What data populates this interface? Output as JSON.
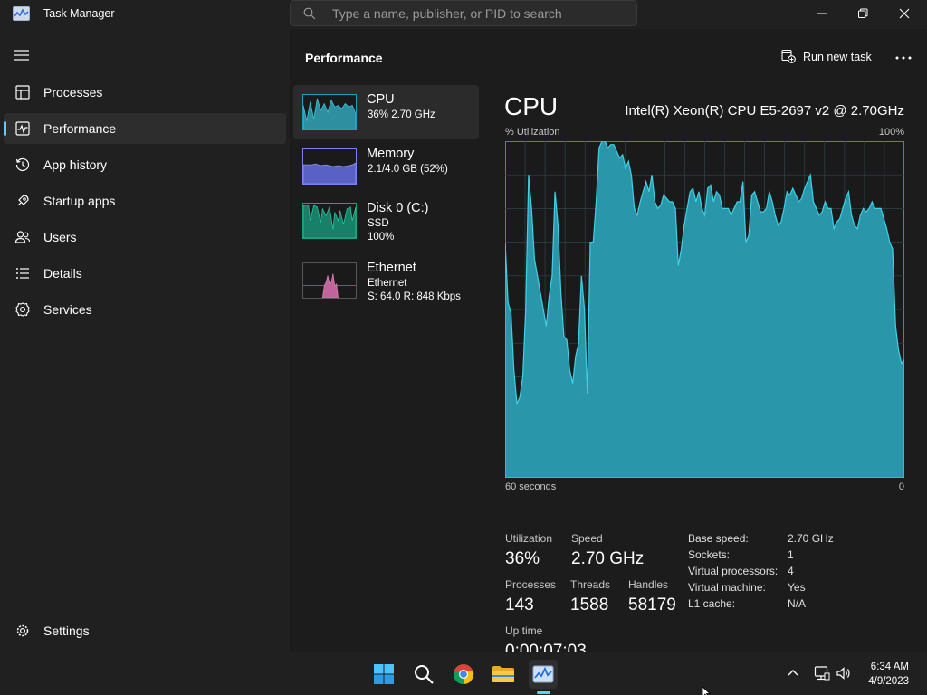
{
  "window": {
    "title": "Task Manager",
    "search_placeholder": "Type a name, publisher, or PID to search"
  },
  "sidebar": {
    "items": [
      {
        "label": "Processes",
        "icon": "processes-icon"
      },
      {
        "label": "Performance",
        "icon": "performance-icon",
        "active": true
      },
      {
        "label": "App history",
        "icon": "app-history-icon"
      },
      {
        "label": "Startup apps",
        "icon": "startup-apps-icon"
      },
      {
        "label": "Users",
        "icon": "users-icon"
      },
      {
        "label": "Details",
        "icon": "details-icon"
      },
      {
        "label": "Services",
        "icon": "services-icon"
      }
    ],
    "settings_label": "Settings"
  },
  "header": {
    "title": "Performance",
    "run_new_task": "Run new task"
  },
  "resources": [
    {
      "name": "CPU",
      "line1": "36%  2.70 GHz",
      "line2": "",
      "color": "#17a2b8",
      "active": true
    },
    {
      "name": "Memory",
      "line1": "2.1/4.0 GB (52%)",
      "line2": "",
      "color": "#7a84e8"
    },
    {
      "name": "Disk 0 (C:)",
      "line1": "SSD",
      "line2": "100%",
      "color": "#1aa380"
    },
    {
      "name": "Ethernet",
      "line1": "Ethernet",
      "line2": "S: 64.0  R: 848 Kbps",
      "color": "#d46aa8"
    }
  ],
  "cpu": {
    "title": "CPU",
    "model": "Intel(R) Xeon(R) CPU E5-2697 v2 @ 2.70GHz",
    "graph_label": "% Utilization",
    "graph_max": "100%",
    "graph_time": "60 seconds",
    "graph_min": "0",
    "stats": {
      "utilization_label": "Utilization",
      "utilization": "36%",
      "speed_label": "Speed",
      "speed": "2.70 GHz",
      "processes_label": "Processes",
      "processes": "143",
      "threads_label": "Threads",
      "threads": "1588",
      "handles_label": "Handles",
      "handles": "58179",
      "uptime_label": "Up time",
      "uptime": "0:00:07:03"
    },
    "specs": [
      {
        "key": "Base speed:",
        "value": "2.70 GHz"
      },
      {
        "key": "Sockets:",
        "value": "1"
      },
      {
        "key": "Virtual processors:",
        "value": "4"
      },
      {
        "key": "Virtual machine:",
        "value": "Yes"
      },
      {
        "key": "L1 cache:",
        "value": "N/A"
      }
    ],
    "history_percent": [
      70,
      52,
      49,
      32,
      22,
      24,
      30,
      50,
      90,
      80,
      65,
      60,
      55,
      50,
      45,
      54,
      60,
      85,
      75,
      55,
      42,
      41,
      32,
      28,
      36,
      40,
      60,
      50,
      25,
      70,
      70,
      82,
      98,
      100,
      100,
      98,
      99,
      99,
      97,
      95,
      96,
      92,
      94,
      90,
      80,
      78,
      82,
      85,
      88,
      85,
      90,
      82,
      80,
      81,
      84,
      83,
      82,
      82,
      80,
      63,
      68,
      75,
      80,
      85,
      86,
      82,
      85,
      80,
      78,
      86,
      87,
      82,
      85,
      84,
      80,
      80,
      80,
      78,
      80,
      82,
      82,
      88,
      70,
      72,
      84,
      85,
      82,
      79,
      79,
      80,
      85,
      82,
      78,
      75,
      76,
      80,
      85,
      84,
      86,
      84,
      82,
      83,
      86,
      88,
      90,
      82,
      80,
      78,
      79,
      82,
      80,
      80,
      74,
      76,
      77,
      80,
      83,
      85,
      78,
      75,
      74,
      78,
      80,
      79,
      80,
      82,
      80,
      80,
      80,
      77,
      74,
      70,
      68,
      45,
      38,
      34,
      35
    ]
  },
  "taskbar": {
    "apps": [
      "start-icon",
      "search-icon",
      "chrome-icon",
      "file-explorer-icon",
      "task-manager-icon"
    ],
    "time": "6:34 AM",
    "date": "4/9/2023"
  }
}
